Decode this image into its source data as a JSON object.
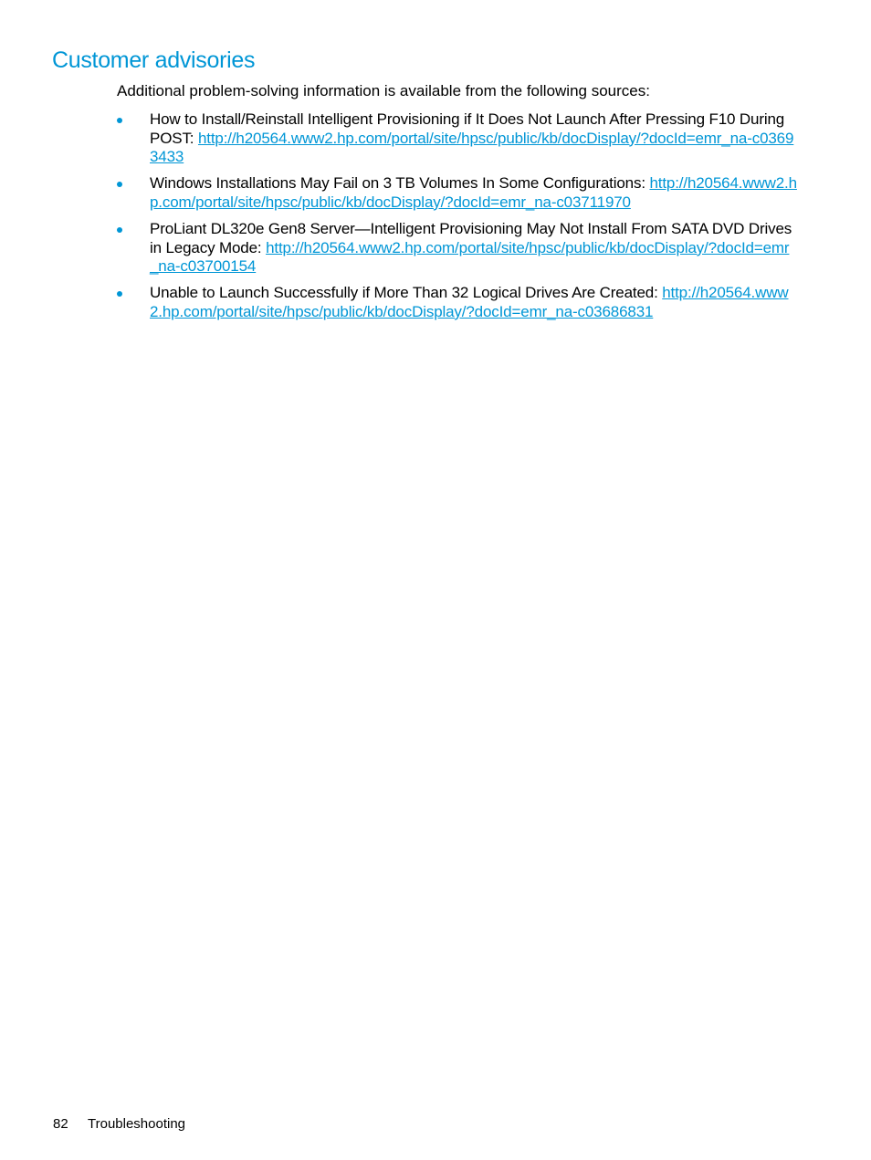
{
  "heading": "Customer advisories",
  "intro": "Additional problem-solving information is available from the following sources:",
  "advisories": [
    {
      "text": "How to Install/Reinstall Intelligent Provisioning if It Does Not Launch After Pressing F10 During POST: ",
      "link": "http://h20564.www2.hp.com/portal/site/hpsc/public/kb/docDisplay/?docId=emr_na-c03693433"
    },
    {
      "text": "Windows Installations May Fail on 3 TB Volumes In Some Configurations: ",
      "link": "http://h20564.www2.hp.com/portal/site/hpsc/public/kb/docDisplay/?docId=emr_na-c03711970"
    },
    {
      "text": "ProLiant DL320e Gen8 Server—Intelligent Provisioning May Not Install From SATA DVD Drives in Legacy Mode: ",
      "link": "http://h20564.www2.hp.com/portal/site/hpsc/public/kb/docDisplay/?docId=emr_na-c03700154"
    },
    {
      "text": "Unable to Launch Successfully if More Than 32 Logical Drives Are Created: ",
      "link": "http://h20564.www2.hp.com/portal/site/hpsc/public/kb/docDisplay/?docId=emr_na-c03686831"
    }
  ],
  "footer": {
    "page_number": "82",
    "section": "Troubleshooting"
  },
  "colors": {
    "accent": "#0096d6",
    "text": "#000000"
  }
}
